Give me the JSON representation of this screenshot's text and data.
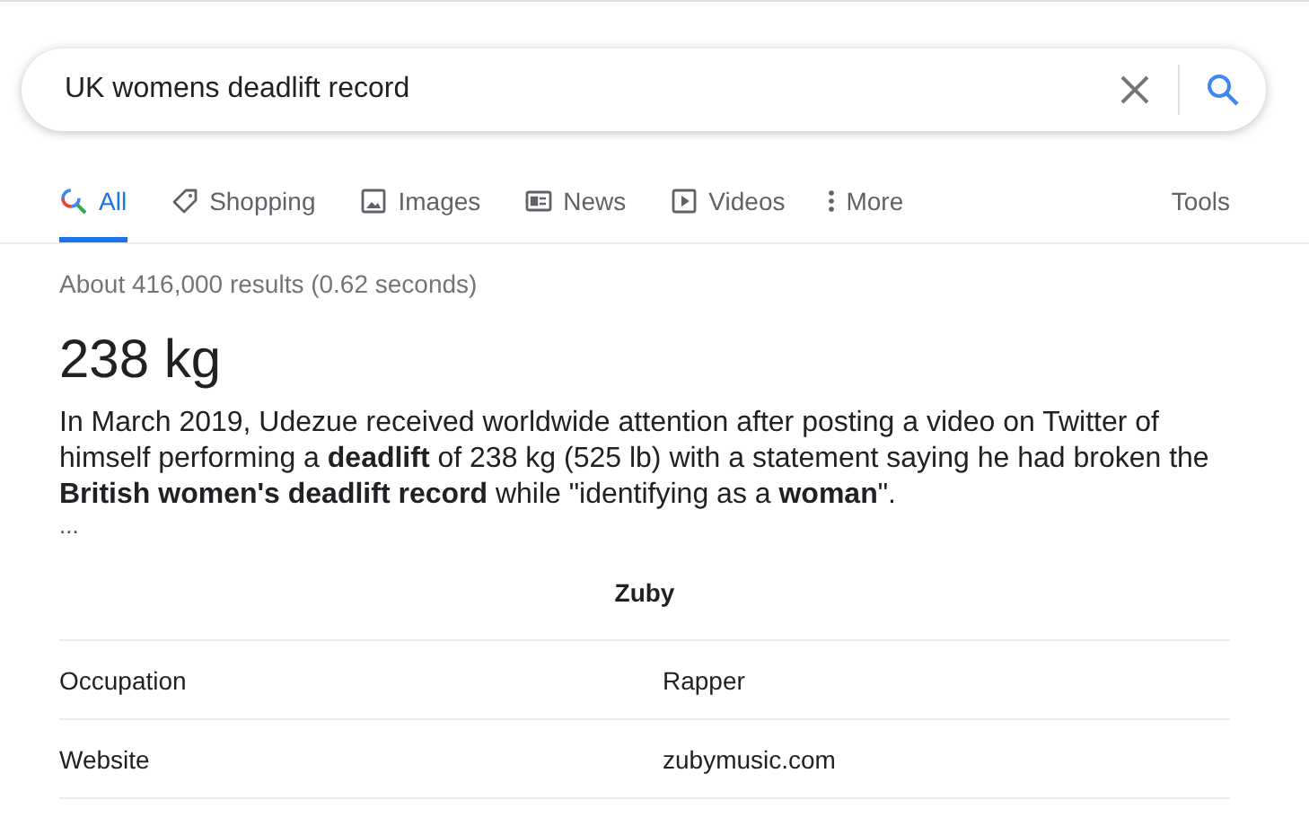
{
  "search": {
    "value": "UK womens deadlift record"
  },
  "tabs": [
    {
      "label": "All",
      "kind": "all",
      "selected": true
    },
    {
      "label": "Shopping",
      "kind": "shopping",
      "selected": false
    },
    {
      "label": "Images",
      "kind": "images",
      "selected": false
    },
    {
      "label": "News",
      "kind": "news",
      "selected": false
    },
    {
      "label": "Videos",
      "kind": "videos",
      "selected": false
    },
    {
      "label": "More",
      "kind": "more",
      "selected": false
    }
  ],
  "tools": "Tools",
  "result_stats": "About 416,000 results (0.62 seconds)",
  "answer": {
    "heading": "238 kg",
    "snippet": "In March 2019, Udezue received worldwide attention after posting a video on Twitter of himself performing a **deadlift** of 238 kg (525 lb) with a statement saying he had broken the **British women's deadlift record** while \"identifying as a **woman**\".",
    "ellipsis": "..."
  },
  "table": {
    "title": "Zuby",
    "rows": [
      {
        "label": "Occupation",
        "value": "Rapper"
      },
      {
        "label": "Website",
        "value": "zubymusic.com"
      }
    ]
  }
}
